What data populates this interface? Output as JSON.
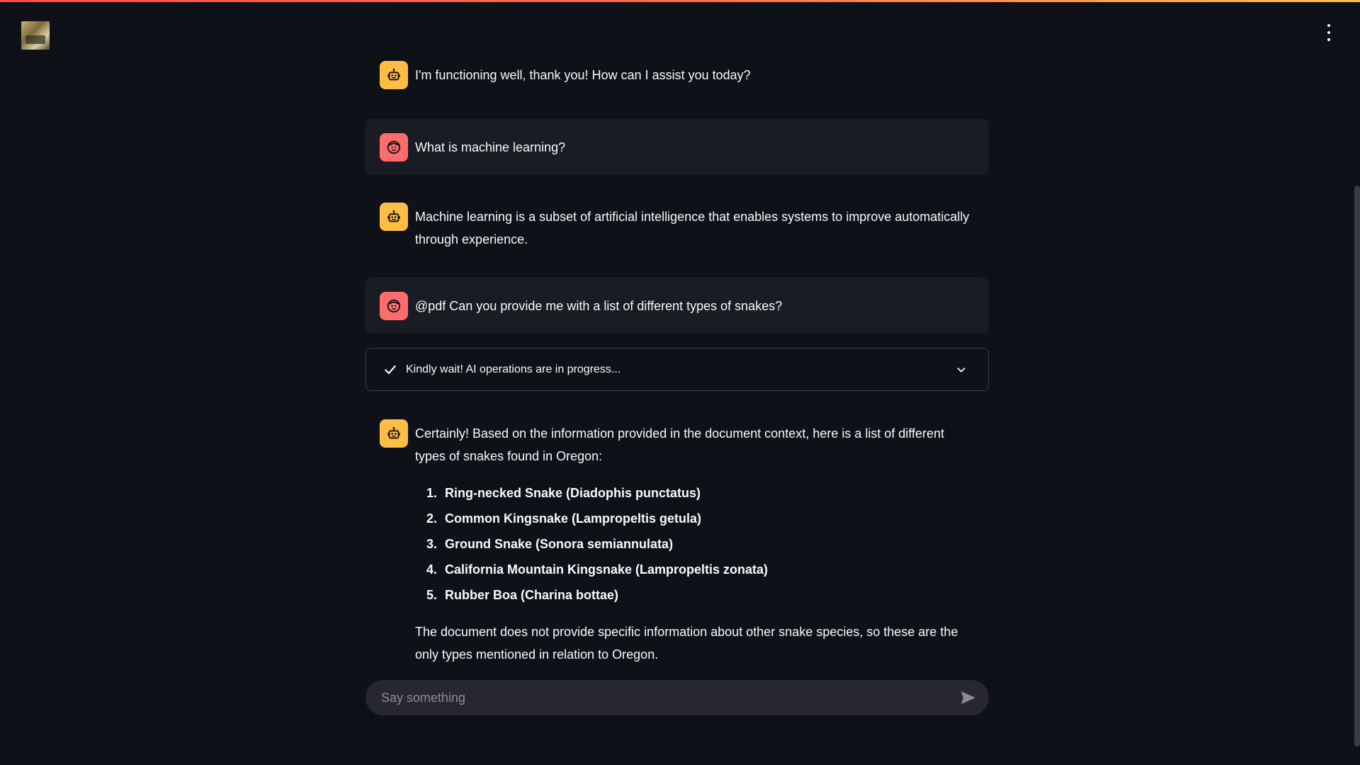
{
  "app": {
    "menu_icon": "vertical-dots-icon",
    "logo_icon": "app-logo-image"
  },
  "messages": [
    {
      "role": "assistant",
      "avatar_icon": "bot-face-icon",
      "text": "I'm functioning well, thank you! How can I assist you today?"
    },
    {
      "role": "user",
      "avatar_icon": "user-face-icon",
      "text": "What is machine learning?"
    },
    {
      "role": "assistant",
      "avatar_icon": "bot-face-icon",
      "text": "Machine learning is a subset of artificial intelligence that enables systems to improve automatically through experience."
    },
    {
      "role": "user",
      "avatar_icon": "user-face-icon",
      "text": "@pdf Can you provide me with a list of different types of snakes?"
    }
  ],
  "status": {
    "icon": "check-icon",
    "label": "Kindly wait! AI operations are in progress...",
    "chevron": "chevron-down-icon"
  },
  "answer": {
    "avatar_icon": "bot-face-icon",
    "intro": "Certainly! Based on the information provided in the document context, here is a list of different types of snakes found in Oregon:",
    "items": [
      "Ring-necked Snake (Diadophis punctatus)",
      "Common Kingsnake (Lampropeltis getula)",
      "Ground Snake (Sonora semiannulata)",
      "California Mountain Kingsnake (Lampropeltis zonata)",
      "Rubber Boa (Charina bottae)"
    ],
    "outro": "The document does not provide specific information about other snake species, so these are the only types mentioned in relation to Oregon."
  },
  "input": {
    "placeholder": "Say something",
    "value": "",
    "send_icon": "send-icon"
  },
  "colors": {
    "background": "#0e1117",
    "user_bubble": "#1a1c24",
    "bot_avatar": "#ffbd45",
    "user_avatar": "#ff6c6c",
    "input_bg": "#262730"
  }
}
